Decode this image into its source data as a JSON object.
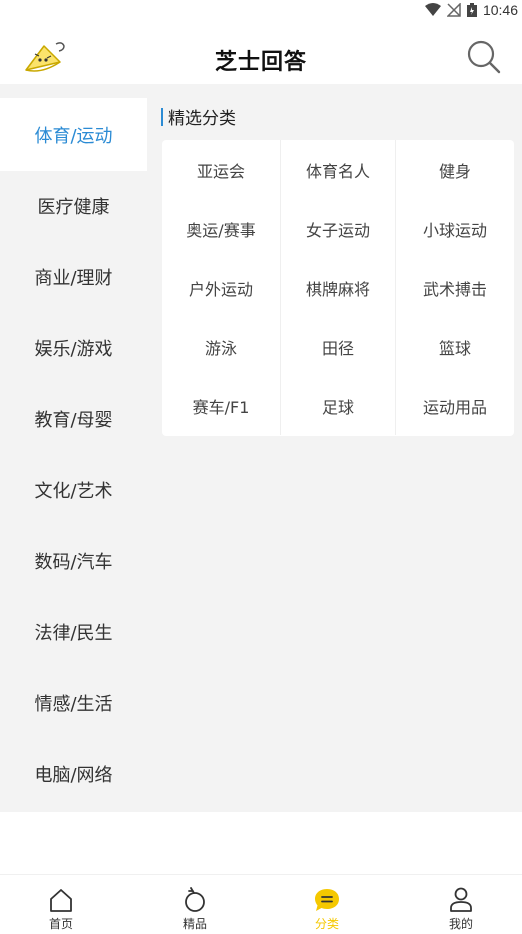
{
  "status_bar": {
    "time": "10:46"
  },
  "header": {
    "title": "芝士回答"
  },
  "sidebar": {
    "items": [
      {
        "label": "体育/运动",
        "active": true
      },
      {
        "label": "医疗健康"
      },
      {
        "label": "商业/理财"
      },
      {
        "label": "娱乐/游戏"
      },
      {
        "label": "教育/母婴"
      },
      {
        "label": "文化/艺术"
      },
      {
        "label": "数码/汽车"
      },
      {
        "label": "法律/民生"
      },
      {
        "label": "情感/生活"
      },
      {
        "label": "电脑/网络"
      }
    ]
  },
  "content": {
    "section_title": "精选分类",
    "categories": [
      "亚运会",
      "体育名人",
      "健身",
      "奥运/赛事",
      "女子运动",
      "小球运动",
      "户外运动",
      "棋牌麻将",
      "武术搏击",
      "游泳",
      "田径",
      "篮球",
      "赛车/F1",
      "足球",
      "运动用品"
    ]
  },
  "bottom_nav": {
    "items": [
      {
        "label": "首页",
        "icon": "home-icon"
      },
      {
        "label": "精品",
        "icon": "ring-icon"
      },
      {
        "label": "分类",
        "icon": "chat-bubble-icon",
        "active": true
      },
      {
        "label": "我的",
        "icon": "person-icon"
      }
    ],
    "active_color": "#f5c800"
  },
  "colors": {
    "accent": "#2b8bd4",
    "brand_yellow": "#f5c800"
  }
}
